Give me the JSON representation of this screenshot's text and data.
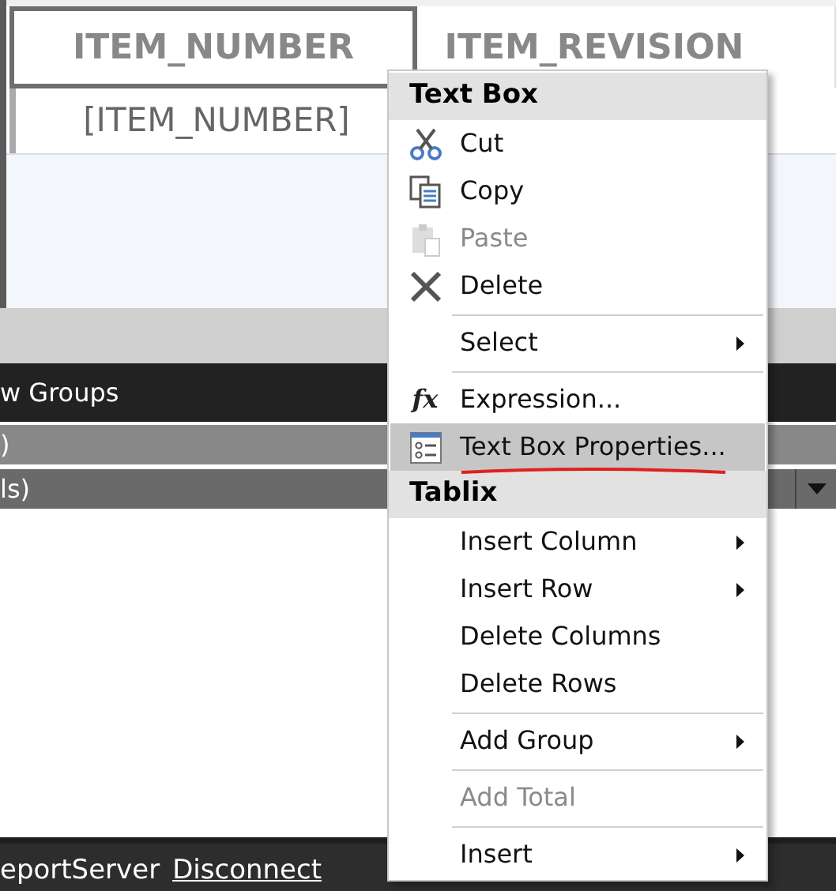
{
  "table": {
    "header": [
      "ITEM_NUMBER",
      "ITEM_REVISION"
    ],
    "row": [
      "[ITEM_NUMBER]"
    ]
  },
  "groups_panel": {
    "title": "w Groups",
    "rows": [
      ")",
      "ls)"
    ]
  },
  "status_bar": {
    "server": "eportServer",
    "link": "Disconnect"
  },
  "context_menu": [
    {
      "kind": "header",
      "label": "Text Box"
    },
    {
      "kind": "item",
      "label": "Cut",
      "disabled": false,
      "submenu": false,
      "selected": false
    },
    {
      "kind": "item",
      "label": "Copy",
      "disabled": false,
      "submenu": false,
      "selected": false
    },
    {
      "kind": "item",
      "label": "Paste",
      "disabled": true,
      "submenu": false,
      "selected": false
    },
    {
      "kind": "item",
      "label": "Delete",
      "disabled": false,
      "submenu": false,
      "selected": false
    },
    {
      "kind": "separator"
    },
    {
      "kind": "item",
      "label": "Select",
      "disabled": false,
      "submenu": true,
      "selected": false
    },
    {
      "kind": "separator"
    },
    {
      "kind": "item",
      "label": "Expression...",
      "glyph": "fx",
      "disabled": false,
      "submenu": false,
      "selected": false
    },
    {
      "kind": "item",
      "label": "Text Box Properties...",
      "disabled": false,
      "submenu": false,
      "selected": true
    },
    {
      "kind": "header",
      "label": "Tablix"
    },
    {
      "kind": "item",
      "label": "Insert Column",
      "disabled": false,
      "submenu": true,
      "selected": false
    },
    {
      "kind": "item",
      "label": "Insert Row",
      "disabled": false,
      "submenu": true,
      "selected": false
    },
    {
      "kind": "item",
      "label": "Delete Columns",
      "disabled": false,
      "submenu": false,
      "selected": false
    },
    {
      "kind": "item",
      "label": "Delete Rows",
      "disabled": false,
      "submenu": false,
      "selected": false
    },
    {
      "kind": "separator"
    },
    {
      "kind": "item",
      "label": "Add Group",
      "disabled": false,
      "submenu": true,
      "selected": false
    },
    {
      "kind": "separator"
    },
    {
      "kind": "item",
      "label": "Add Total",
      "disabled": true,
      "submenu": false,
      "selected": false
    },
    {
      "kind": "separator"
    },
    {
      "kind": "item",
      "label": "Insert",
      "disabled": false,
      "submenu": true,
      "selected": false
    }
  ]
}
